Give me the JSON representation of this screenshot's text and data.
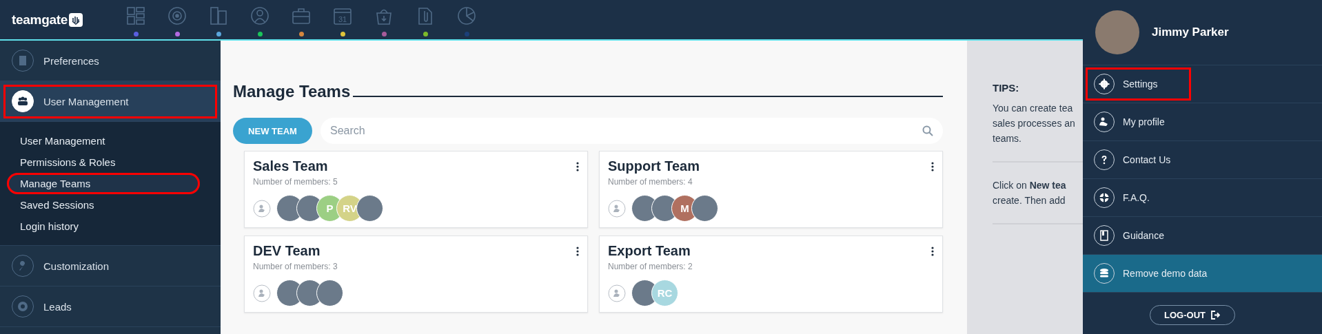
{
  "topbar": {
    "logo": "teamgate",
    "nav_icons": [
      {
        "color": "#5a5fe0"
      },
      {
        "color": "#b36ae2"
      },
      {
        "color": "#5aa6dc"
      },
      {
        "color": "#1ac45a"
      },
      {
        "color": "#d4863e"
      },
      {
        "color": "#e0c33a",
        "text": "31"
      },
      {
        "color": "#a75b9a"
      },
      {
        "color": "#7cb92a"
      },
      {
        "color": "#1b3f78"
      }
    ]
  },
  "sidebar": {
    "items": [
      {
        "label": "Preferences",
        "selected": false,
        "annotated": false
      },
      {
        "label": "User Management",
        "selected": true,
        "annotated": true,
        "expanded": true,
        "children": [
          {
            "label": "User Management",
            "selected": false,
            "annotated": false
          },
          {
            "label": "Permissions & Roles",
            "selected": false,
            "annotated": false
          },
          {
            "label": "Manage Teams",
            "selected": true,
            "annotated": true
          },
          {
            "label": "Saved Sessions",
            "selected": false,
            "annotated": false
          },
          {
            "label": "Login history",
            "selected": false,
            "annotated": false
          }
        ]
      },
      {
        "label": "Customization",
        "selected": false,
        "annotated": false
      },
      {
        "label": "Leads",
        "selected": false,
        "annotated": false
      }
    ]
  },
  "main": {
    "title": "Manage Teams",
    "new_button": "NEW TEAM",
    "search": {
      "placeholder": "Search"
    },
    "teams": [
      {
        "name": "Sales Team",
        "members_text": "Number of members: 5",
        "members": [
          {
            "kind": "photo"
          },
          {
            "kind": "photo"
          },
          {
            "kind": "initials",
            "text": "P",
            "color": "#9ccf84"
          },
          {
            "kind": "initials",
            "text": "RV",
            "color": "#d4d388"
          },
          {
            "kind": "photo"
          }
        ]
      },
      {
        "name": "Support Team",
        "members_text": "Number of members: 4",
        "members": [
          {
            "kind": "photo"
          },
          {
            "kind": "photo"
          },
          {
            "kind": "initials",
            "text": "M",
            "color": "#b07060"
          },
          {
            "kind": "photo"
          }
        ]
      },
      {
        "name": "DEV Team",
        "members_text": "Number of members: 3",
        "members": [
          {
            "kind": "photo"
          },
          {
            "kind": "photo"
          },
          {
            "kind": "photo"
          }
        ]
      },
      {
        "name": "Export Team",
        "members_text": "Number of members: 2",
        "members": [
          {
            "kind": "photo"
          },
          {
            "kind": "initials",
            "text": "RC",
            "color": "#a8d8e0"
          }
        ]
      }
    ]
  },
  "tips": {
    "title": "TIPS:",
    "paragraphs": [
      {
        "lines": [
          "You can create tea",
          "sales processes an",
          "teams."
        ]
      },
      {
        "lines": [
          "Click on **New tea**",
          "create. Then add"
        ]
      }
    ]
  },
  "user_menu": {
    "name": "Jimmy Parker",
    "items": [
      {
        "label": "Settings",
        "selected": false,
        "annotated": true
      },
      {
        "label": "My profile",
        "selected": false,
        "annotated": false
      },
      {
        "label": "Contact Us",
        "selected": false,
        "annotated": false
      },
      {
        "label": "F.A.Q.",
        "selected": false,
        "annotated": false
      },
      {
        "label": "Guidance",
        "selected": false,
        "annotated": false
      },
      {
        "label": "Remove demo data",
        "selected": true,
        "annotated": false
      }
    ],
    "logout": "LOG-OUT"
  }
}
